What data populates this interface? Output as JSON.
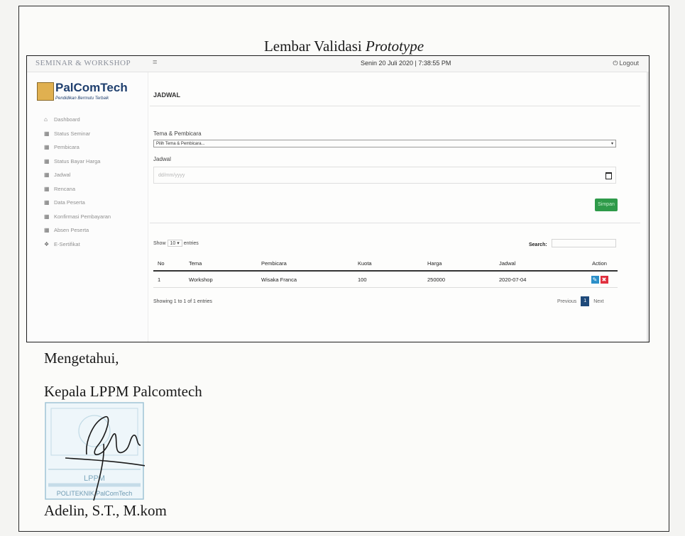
{
  "document": {
    "title_plain": "Lembar Validasi",
    "title_italic": "Prototype",
    "acknowledged": "Mengetahui,",
    "position": "Kepala LPPM Palcomtech",
    "signer": "Adelin, S.T., M.kom",
    "stamp_lines": [
      "LPPM",
      "POLITEKNIK PalComTech"
    ]
  },
  "app": {
    "name": "SEMINAR & WORKSHOP",
    "menu_icon": "hamburger-icon",
    "datetime": "Senin 20 Juli 2020 | 7:38:55 PM",
    "logout": "Logout",
    "logo_text": "PalComTech",
    "logo_tagline": "Pendidikan Bermutu Terbaik"
  },
  "sidebar": {
    "items": [
      {
        "label": "Dashboard",
        "icon": "home-icon"
      },
      {
        "label": "Status Seminar",
        "icon": "table-icon"
      },
      {
        "label": "Pembicara",
        "icon": "table-icon"
      },
      {
        "label": "Status Bayar Harga",
        "icon": "table-icon"
      },
      {
        "label": "Jadwal",
        "icon": "table-icon"
      },
      {
        "label": "Rencana",
        "icon": "table-icon"
      },
      {
        "label": "Data Peserta",
        "icon": "table-icon"
      },
      {
        "label": "Konfirmasi Pembayaran",
        "icon": "table-icon"
      },
      {
        "label": "Absen Peserta",
        "icon": "table-icon"
      },
      {
        "label": "E-Sertifikat",
        "icon": "certificate-icon"
      }
    ]
  },
  "main": {
    "page_title": "JADWAL",
    "form": {
      "tema_label": "Tema & Pembicara",
      "tema_value": "Pilih Tema & Pembicara...",
      "jadwal_label": "Jadwal",
      "jadwal_placeholder": "dd/mm/yyyy",
      "save_label": "Simpan"
    },
    "table": {
      "show_prefix": "Show",
      "show_value": "10",
      "show_suffix": "entries",
      "search_label": "Search:",
      "columns": [
        "No",
        "Tema",
        "Pembicara",
        "Kuota",
        "Harga",
        "Jadwal",
        "Action"
      ],
      "rows": [
        {
          "no": "1",
          "tema": "Workshop",
          "pembicara": "Wisaka Franca",
          "kuota": "100",
          "harga": "250000",
          "jadwal": "2020-07-04"
        }
      ],
      "info": "Showing 1 to 1 of 1 entries",
      "prev": "Previous",
      "page": "1",
      "next": "Next"
    }
  },
  "colors": {
    "save_button": "#2e9a49",
    "edit_button": "#2b8fc8",
    "delete_button": "#e0303e",
    "active_page": "#1f4a7a",
    "logo_blue": "#1f3f6e"
  }
}
